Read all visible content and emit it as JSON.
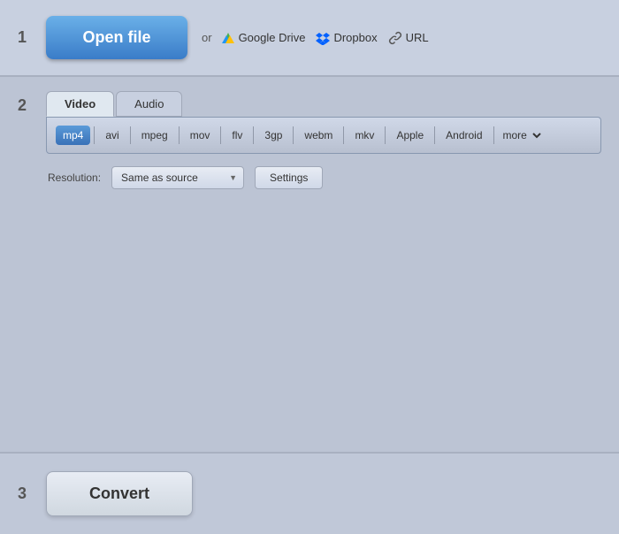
{
  "steps": {
    "one": "1",
    "two": "2",
    "three": "3"
  },
  "section1": {
    "open_file_label": "Open file",
    "or_text": "or",
    "google_drive_label": "Google Drive",
    "dropbox_label": "Dropbox",
    "url_label": "URL"
  },
  "section2": {
    "tabs": [
      {
        "id": "video",
        "label": "Video",
        "active": true
      },
      {
        "id": "audio",
        "label": "Audio",
        "active": false
      }
    ],
    "formats": [
      {
        "id": "mp4",
        "label": "mp4",
        "active": true
      },
      {
        "id": "avi",
        "label": "avi",
        "active": false
      },
      {
        "id": "mpeg",
        "label": "mpeg",
        "active": false
      },
      {
        "id": "mov",
        "label": "mov",
        "active": false
      },
      {
        "id": "flv",
        "label": "flv",
        "active": false
      },
      {
        "id": "3gp",
        "label": "3gp",
        "active": false
      },
      {
        "id": "webm",
        "label": "webm",
        "active": false
      },
      {
        "id": "mkv",
        "label": "mkv",
        "active": false
      },
      {
        "id": "apple",
        "label": "Apple",
        "active": false
      },
      {
        "id": "android",
        "label": "Android",
        "active": false
      }
    ],
    "more_label": "more",
    "resolution_label": "Resolution:",
    "resolution_value": "Same as source",
    "settings_label": "Settings"
  },
  "section3": {
    "convert_label": "Convert"
  }
}
